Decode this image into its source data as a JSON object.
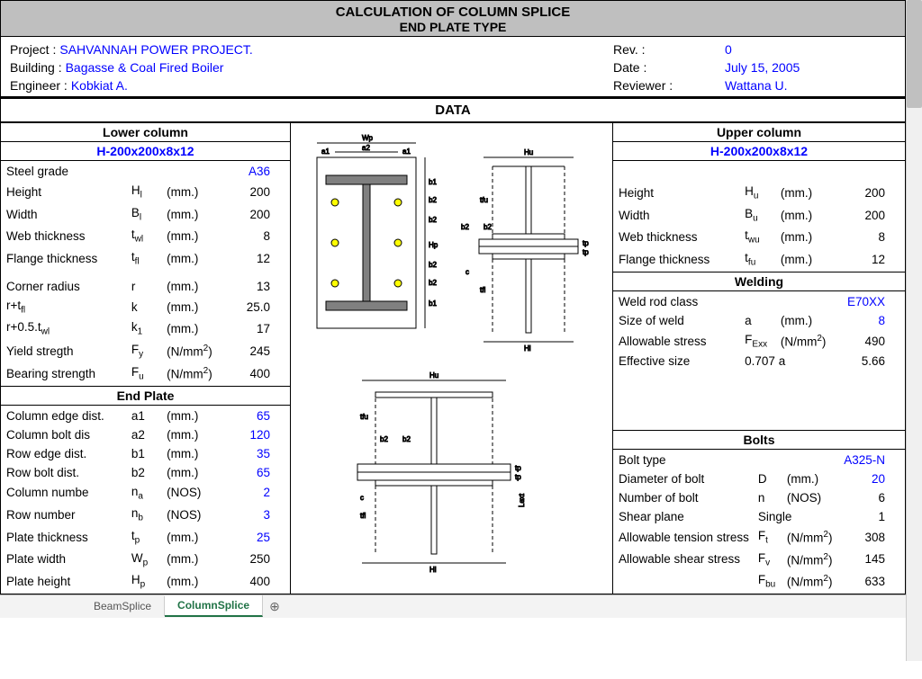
{
  "title": {
    "line1": "CALCULATION OF COLUMN SPLICE",
    "line2": "END PLATE TYPE"
  },
  "header": {
    "project_label": "Project :",
    "project": "SAHVANNAH POWER PROJECT.",
    "building_label": "Building :",
    "building": "Bagasse & Coal Fired Boiler",
    "engineer_label": "Engineer :",
    "engineer": "Kobkiat A.",
    "rev_label": "Rev. :",
    "rev": "0",
    "date_label": "Date :",
    "date": "July 15, 2005",
    "reviewer_label": "Reviewer :",
    "reviewer": "Wattana U."
  },
  "section_data": "DATA",
  "lower": {
    "title": "Lower column",
    "member": "H-200x200x8x12",
    "steel_grade_l": "Steel grade",
    "steel_grade": "A36",
    "height_l": "Height",
    "height_s": "Hₗ",
    "height_u": "(mm.)",
    "height": "200",
    "width_l": "Width",
    "width_s": "Bₗ",
    "width_u": "(mm.)",
    "width": "200",
    "web_l": "Web thickness",
    "web_s": "t_wl",
    "web_u": "(mm.)",
    "web": "8",
    "flange_l": "Flange thickness",
    "flange_s": "t_fl",
    "flange_u": "(mm.)",
    "flange": "12",
    "corner_l": "Corner radius",
    "corner_s": "r",
    "corner_u": "(mm.)",
    "corner": "13",
    "k_l": "r+t_fl",
    "k_s": "k",
    "k_u": "(mm.)",
    "k": "25.0",
    "k1_l": "r+0.5.t_wl",
    "k1_s": "k₁",
    "k1_u": "(mm.)",
    "k1": "17",
    "fy_l": "Yield stregth",
    "fy_s": "F_y",
    "fy_u": "(N/mm²)",
    "fy": "245",
    "fu_l": "Bearing strength",
    "fu_s": "F_u",
    "fu_u": "(N/mm²)",
    "fu": "400"
  },
  "endplate": {
    "title": "End Plate",
    "a1_l": "Column edge dist.",
    "a1_s": "a1",
    "a1_u": "(mm.)",
    "a1": "65",
    "a2_l": "Column bolt dis",
    "a2_s": "a2",
    "a2_u": "(mm.)",
    "a2": "120",
    "b1_l": "Row edge dist.",
    "b1_s": "b1",
    "b1_u": "(mm.)",
    "b1": "35",
    "b2_l": "Row bolt dist.",
    "b2_s": "b2",
    "b2_u": "(mm.)",
    "b2": "65",
    "na_l": "Column numbe",
    "na_s": "nₐ",
    "na_u": "(NOS)",
    "na": "2",
    "nb_l": "Row number",
    "nb_s": "n_b",
    "nb_u": "(NOS)",
    "nb": "3",
    "tp_l": "Plate thickness",
    "tp_s": "t_p",
    "tp_u": "(mm.)",
    "tp": "25",
    "wp_l": "Plate width",
    "wp_s": "W_p",
    "wp_u": "(mm.)",
    "wp": "250",
    "hp_l": "Plate height",
    "hp_s": "H_p",
    "hp_u": "(mm.)",
    "hp": "400"
  },
  "upper": {
    "title": "Upper column",
    "member": "H-200x200x8x12",
    "height_l": "Height",
    "height_s": "Hᵤ",
    "height_u": "(mm.)",
    "height": "200",
    "width_l": "Width",
    "width_s": "Bᵤ",
    "width_u": "(mm.)",
    "width": "200",
    "web_l": "Web thickness",
    "web_s": "t_wu",
    "web_u": "(mm.)",
    "web": "8",
    "flange_l": "Flange thickness",
    "flange_s": "t_fu",
    "flange_u": "(mm.)",
    "flange": "12"
  },
  "welding": {
    "title": "Welding",
    "class_l": "Weld rod class",
    "class": "E70XX",
    "size_l": "Size of weld",
    "size_s": "a",
    "size_u": "(mm.)",
    "size": "8",
    "fexx_l": "Allowable stress",
    "fexx_s": "F_Exx",
    "fexx_u": "(N/mm²)",
    "fexx": "490",
    "eff_l": "Effective size",
    "eff_s": "0.707 a",
    "eff": "5.66"
  },
  "bolts": {
    "title": "Bolts",
    "type_l": "Bolt type",
    "type": "A325-N",
    "dia_l": "Diameter of bolt",
    "dia_s": "D",
    "dia_u": "(mm.)",
    "dia": "20",
    "num_l": "Number of bolt",
    "num_s": "n",
    "num_u": "(NOS)",
    "num": "6",
    "plane_l": "Shear plane",
    "plane_s": "Single",
    "plane": "1",
    "ft_l": "Allowable tension stress",
    "ft_s": "F_t",
    "ft_u": "(N/mm²)",
    "ft": "308",
    "fv_l": "Allowable shear stress",
    "fv_s": "F_v",
    "fv_u": "(N/mm²)",
    "fv": "145",
    "fbu_s": "F_bu",
    "fbu_u": "(N/mm²)",
    "fbu": "633"
  },
  "tabs": {
    "t1": "BeamSplice",
    "t2": "ColumnSplice"
  }
}
